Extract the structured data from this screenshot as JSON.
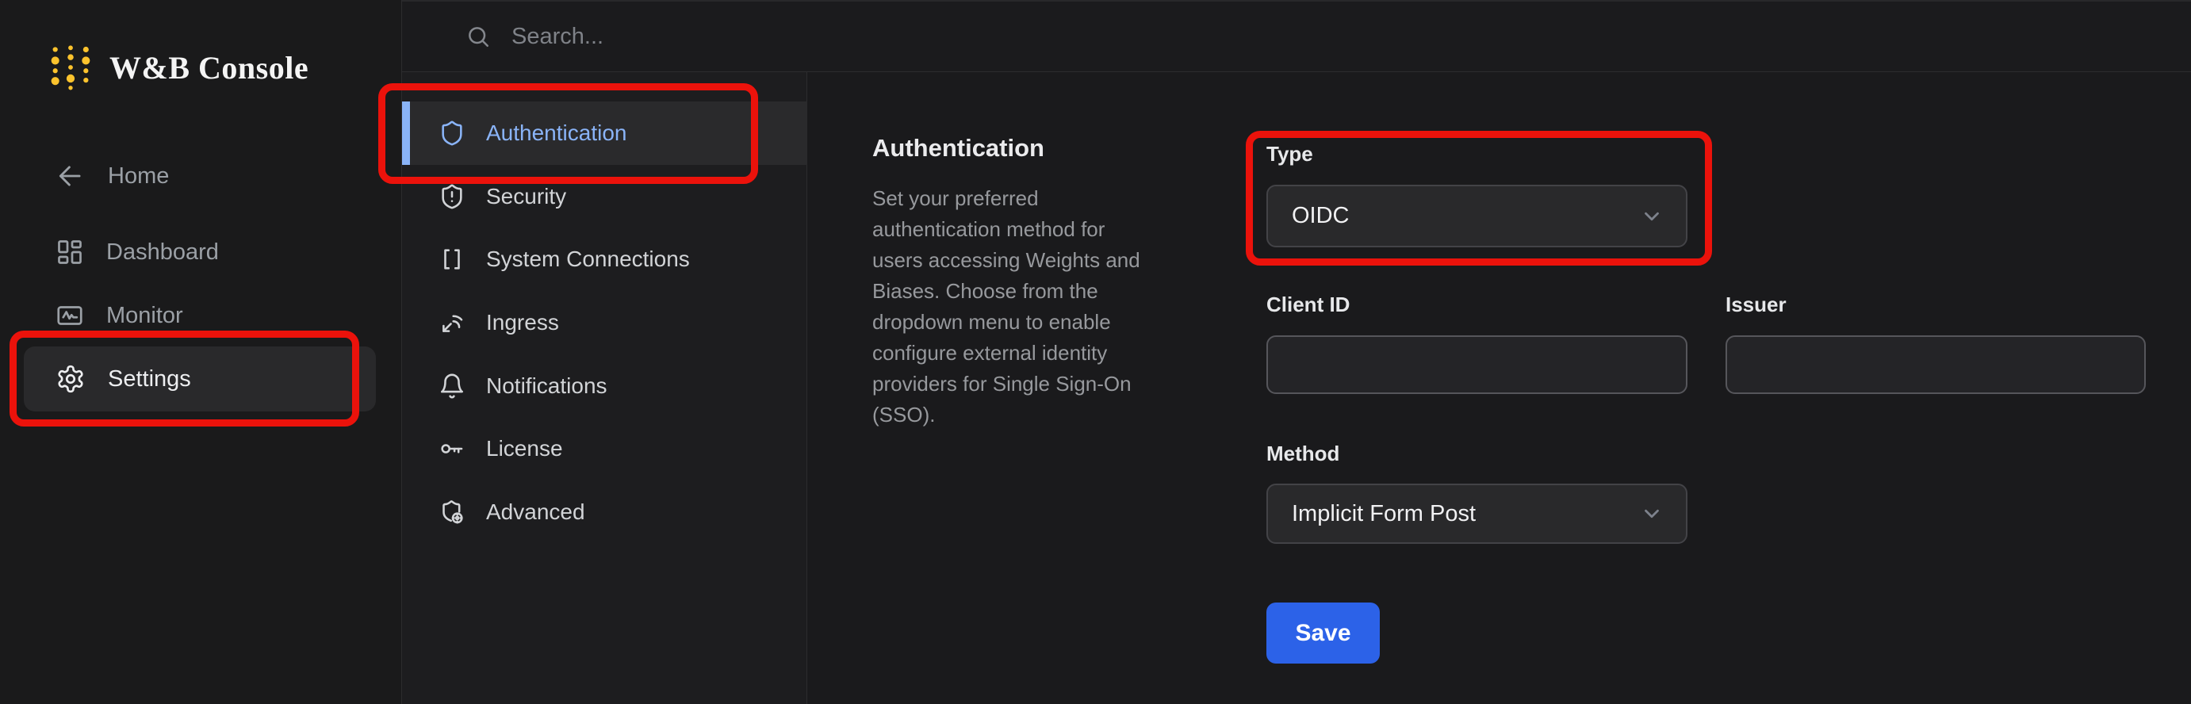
{
  "app": {
    "title": "W&B Console"
  },
  "topbar": {
    "search_placeholder": "Search..."
  },
  "sidebar": {
    "items": [
      {
        "label": "Home",
        "icon": "arrow-left-icon",
        "active": false
      },
      {
        "label": "Dashboard",
        "icon": "dashboard-grid-icon",
        "active": false
      },
      {
        "label": "Monitor",
        "icon": "monitor-activity-icon",
        "active": false
      },
      {
        "label": "Settings",
        "icon": "gear-icon",
        "active": true
      }
    ]
  },
  "settings_nav": {
    "items": [
      {
        "label": "Authentication",
        "icon": "shield-icon",
        "active": true
      },
      {
        "label": "Security",
        "icon": "shield-alert-icon",
        "active": false
      },
      {
        "label": "System Connections",
        "icon": "brackets-icon",
        "active": false
      },
      {
        "label": "Ingress",
        "icon": "ingress-signal-icon",
        "active": false
      },
      {
        "label": "Notifications",
        "icon": "bell-icon",
        "active": false
      },
      {
        "label": "License",
        "icon": "key-icon",
        "active": false
      },
      {
        "label": "Advanced",
        "icon": "shield-cog-icon",
        "active": false
      }
    ]
  },
  "content": {
    "heading": "Authentication",
    "description": "Set your preferred\nauthentication method for\nusers accessing Weights and\nBiases. Choose from the\ndropdown menu to enable\nconfigure external identity\nproviders for Single Sign-On\n(SSO)."
  },
  "form": {
    "type_label": "Type",
    "type_value": "OIDC",
    "client_id_label": "Client ID",
    "client_id_value": "",
    "issuer_label": "Issuer",
    "issuer_value": "",
    "method_label": "Method",
    "method_value": "Implicit Form Post",
    "save_label": "Save"
  },
  "annotations": {
    "boxes": [
      "settings-nav-item",
      "authentication-nav-item",
      "type-dropdown"
    ]
  },
  "colors": {
    "accent_blue": "#8ab4f8",
    "save_blue": "#2c62e8",
    "annotation_red": "#eb120b",
    "logo_yellow": "#fcc32d"
  }
}
